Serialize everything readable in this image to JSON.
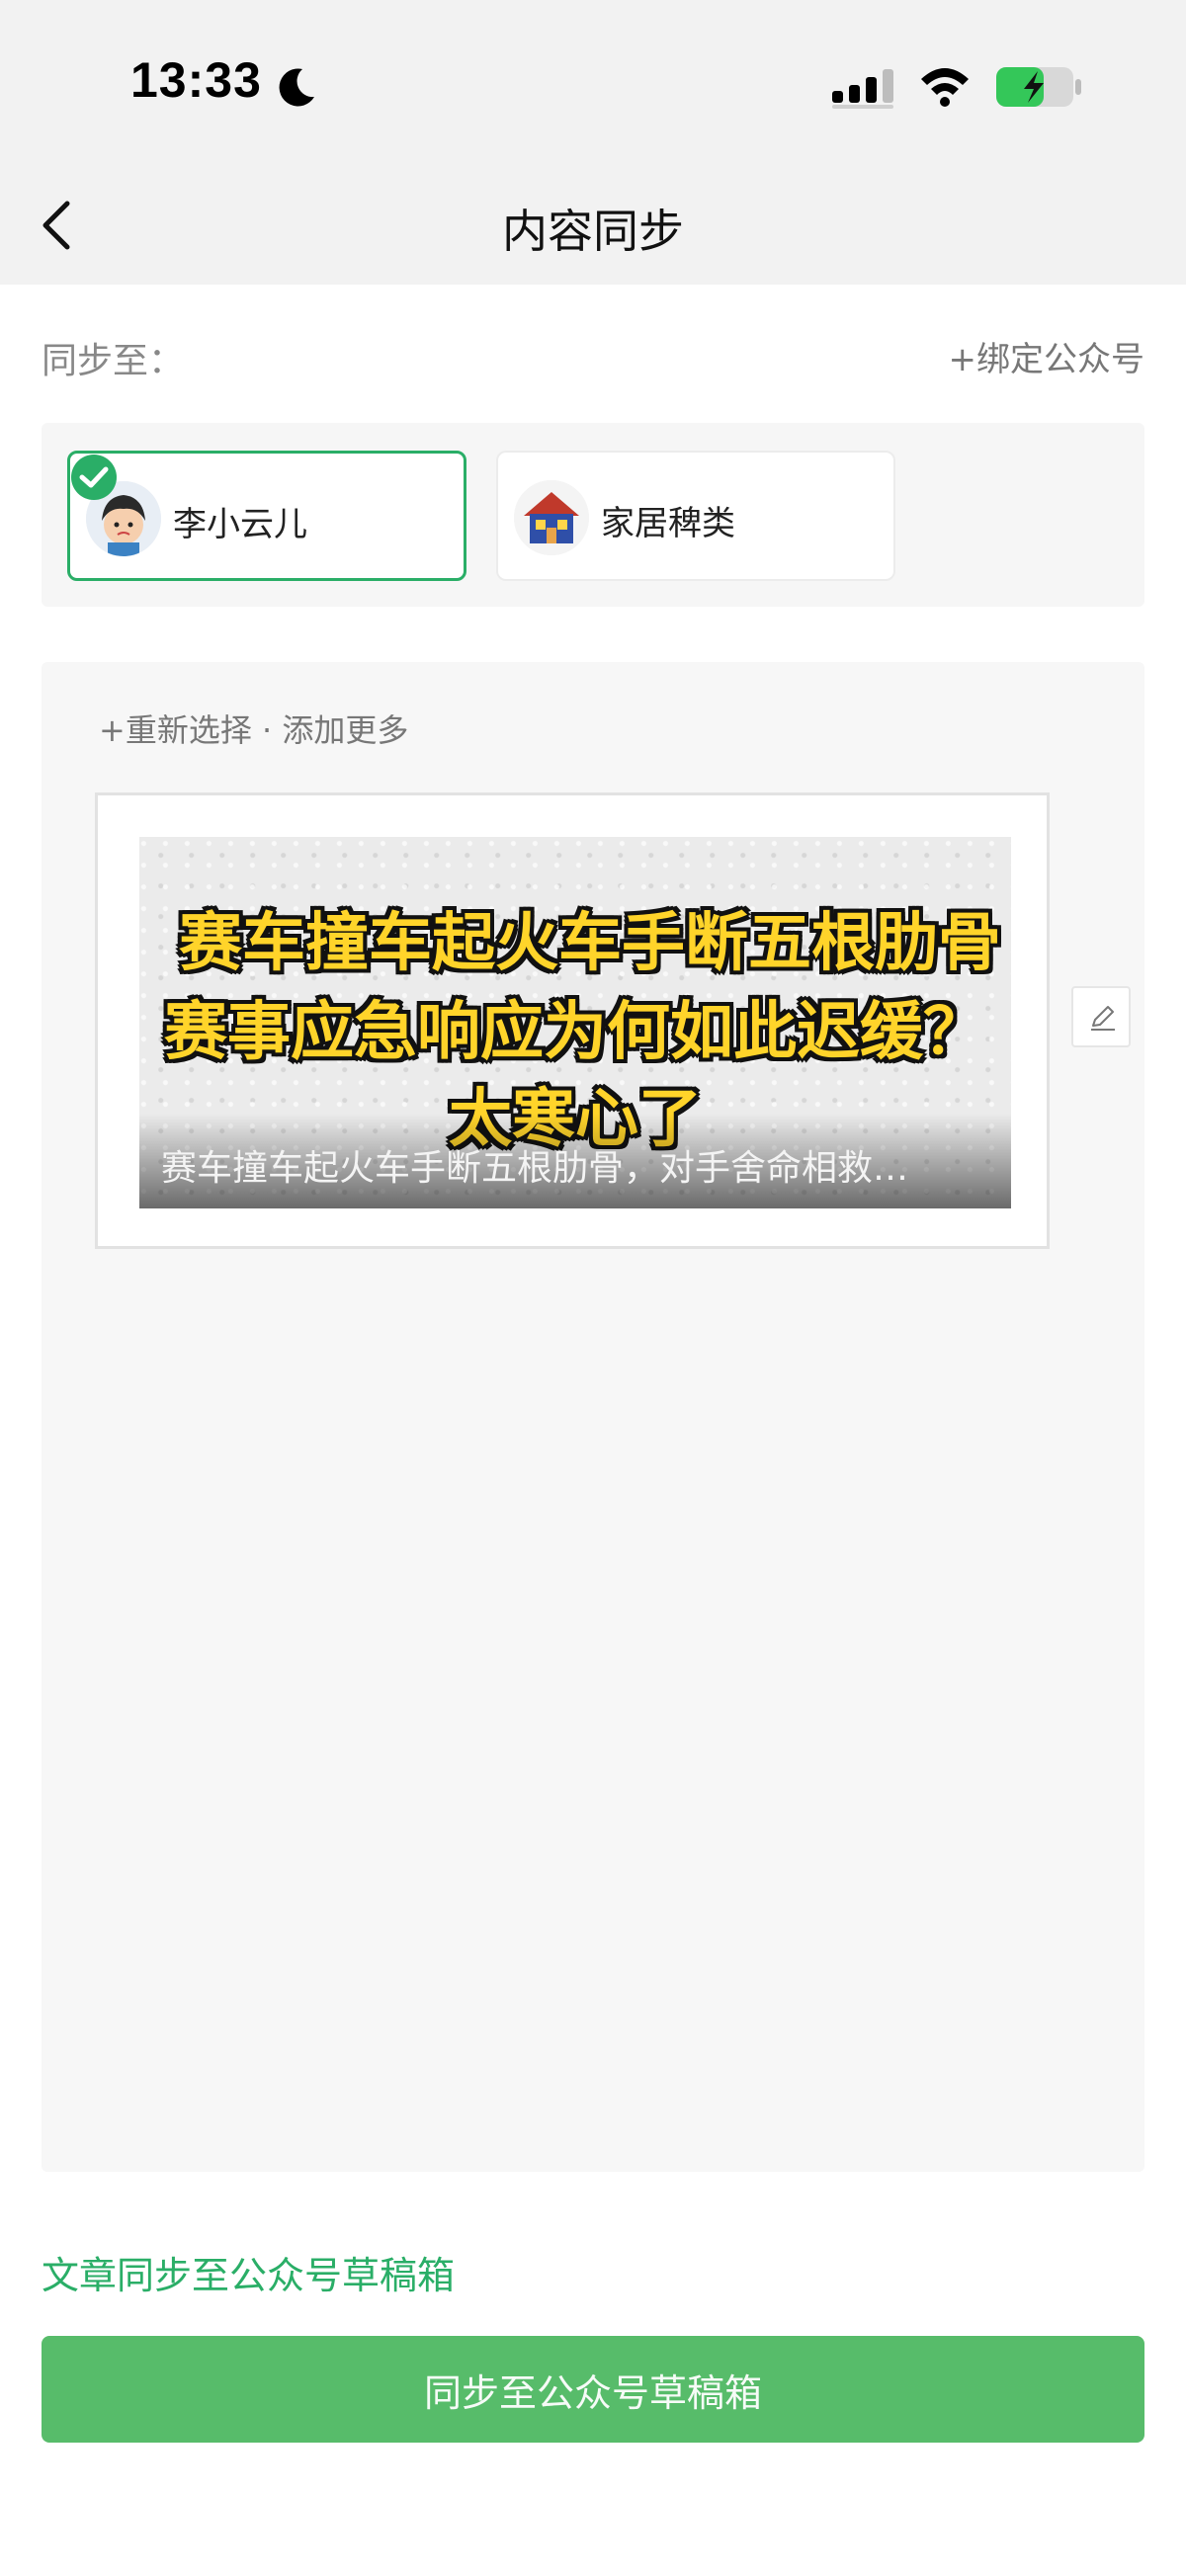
{
  "status_bar": {
    "time": "13:33",
    "icons": [
      "moon-icon",
      "signal-icon",
      "wifi-icon",
      "battery-charging-icon"
    ]
  },
  "nav": {
    "title": "内容同步",
    "back_icon": "chevron-left-icon"
  },
  "sync": {
    "label": "同步至：",
    "bind_link": "+绑定公众号"
  },
  "accounts": [
    {
      "name": "李小云儿",
      "selected": true,
      "avatar": "cartoon-girl-avatar"
    },
    {
      "name": "家居稗类",
      "selected": false,
      "avatar": "house-avatar"
    }
  ],
  "content": {
    "reselect": "+重新选择 · 添加更多",
    "article": {
      "cover_lines": [
        "赛车撞车起火车手断五根肋骨",
        "赛事应急响应为何如此迟缓？",
        "太寒心了"
      ],
      "caption": "赛车撞车起火车手断五根肋骨，对手舍命相救…"
    },
    "edit_icon": "pencil-icon"
  },
  "footer": {
    "note": "文章同步至公众号草稿箱",
    "button": "同步至公众号草稿箱"
  },
  "colors": {
    "accent": "#2aae67",
    "button": "#57bc6a",
    "cover_text": "#ffd42a"
  }
}
